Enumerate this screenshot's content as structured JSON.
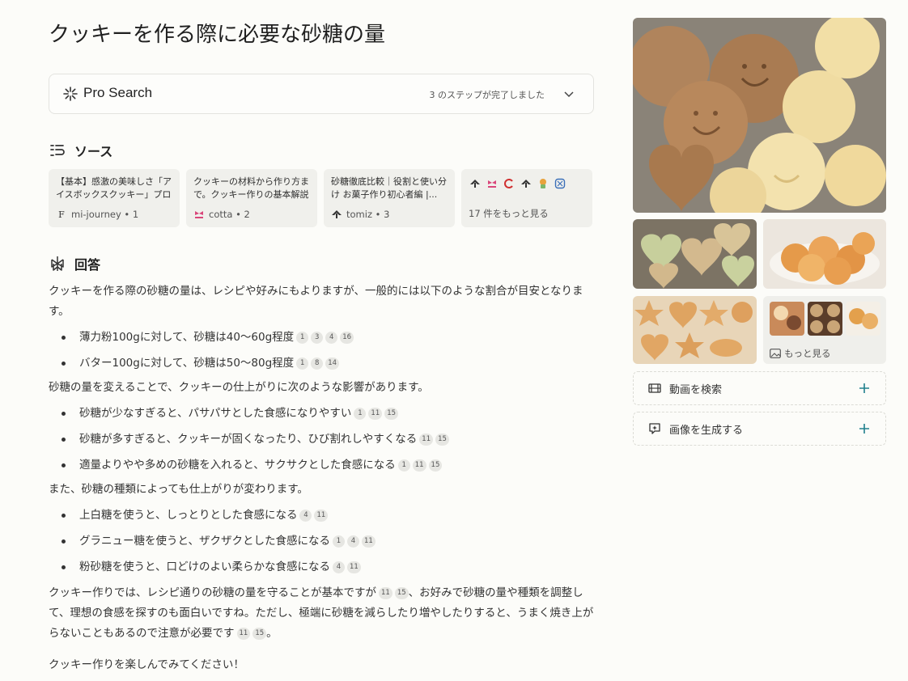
{
  "page": {
    "title": "クッキーを作る際に必要な砂糖の量"
  },
  "pro_search": {
    "label": "Pro Search",
    "status": "3 のステップが完了しました"
  },
  "sources": {
    "heading": "ソース",
    "items": [
      {
        "title": "【基本】感激の美味しさ「アイスボックスクッキー」プロのレシ...",
        "site": "mi-journey",
        "num": "1",
        "favicon": "F"
      },
      {
        "title": "クッキーの材料から作り方まで。クッキー作りの基本解説 -...",
        "site": "cotta",
        "num": "2",
        "favicon": "cotta-icon"
      },
      {
        "title": "砂糖徹底比較｜役割と使い分け お菓子作り初心者編 |...",
        "site": "tomiz",
        "num": "3",
        "favicon": "tomiz-icon"
      }
    ],
    "more_label": "17 件をもっと見る"
  },
  "answer": {
    "heading": "回答",
    "intro": "クッキーを作る際の砂糖の量は、レシピや好みにもよりますが、一般的には以下のような割合が目安となります。",
    "list1": [
      {
        "text": "薄力粉100gに対して、砂糖は40～60g程度",
        "cites": [
          "1",
          "3",
          "4",
          "16"
        ]
      },
      {
        "text": "バター100gに対して、砂糖は50～80g程度",
        "cites": [
          "1",
          "8",
          "14"
        ]
      }
    ],
    "para2": "砂糖の量を変えることで、クッキーの仕上がりに次のような影響があります。",
    "list2": [
      {
        "text": "砂糖が少なすぎると、パサパサとした食感になりやすい",
        "cites": [
          "1",
          "11",
          "15"
        ]
      },
      {
        "text": "砂糖が多すぎると、クッキーが固くなったり、ひび割れしやすくなる",
        "cites": [
          "11",
          "15"
        ]
      },
      {
        "text": "適量よりやや多めの砂糖を入れると、サクサクとした食感になる",
        "cites": [
          "1",
          "11",
          "15"
        ]
      }
    ],
    "para3": "また、砂糖の種類によっても仕上がりが変わります。",
    "list3": [
      {
        "text": "上白糖を使うと、しっとりとした食感になる",
        "cites": [
          "4",
          "11"
        ]
      },
      {
        "text": "グラニュー糖を使うと、ザクザクとした食感になる",
        "cites": [
          "1",
          "4",
          "11"
        ]
      },
      {
        "text": "粉砂糖を使うと、口どけのよい柔らかな食感になる",
        "cites": [
          "4",
          "11"
        ]
      }
    ],
    "para4_a": "クッキー作りでは、レシピ通りの砂糖の量を守ることが基本ですが",
    "para4_cites_a": [
      "11",
      "15"
    ],
    "para4_b": "、お好みで砂糖の量や種類を調整して、理想の食感を探すのも面白いですね。ただし、極端に砂糖を減らしたり増やしたりすると、うまく焼き上がらないこともあるので注意が必要です",
    "para4_cites_b": [
      "11",
      "15"
    ],
    "para4_end": "。",
    "closing": "クッキー作りを楽しんでみてください！"
  },
  "sidebar": {
    "more_images_label": "もっと見る",
    "search_videos_label": "動画を検索",
    "generate_image_label": "画像を生成する"
  },
  "colors": {
    "accent": "#20808d",
    "background": "#fcfcf9",
    "card": "#f0f0ec"
  }
}
